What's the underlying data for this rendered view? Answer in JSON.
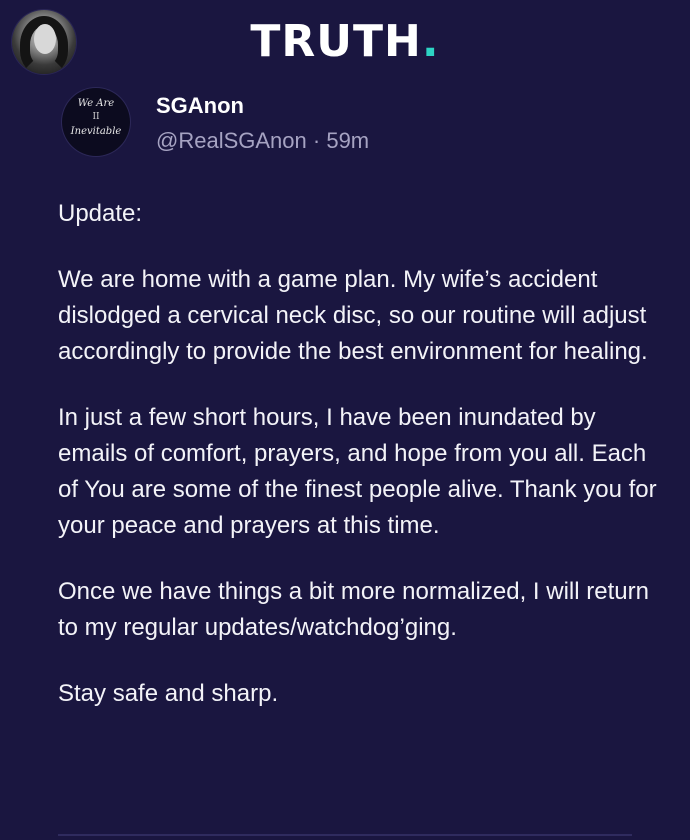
{
  "app": {
    "brand_text": "TRUTH",
    "brand_dot": ".",
    "accent_color": "#2dd4c4",
    "background_color": "#1a1640"
  },
  "viewer": {
    "avatar_icon": "user-avatar-photo"
  },
  "post": {
    "author": {
      "display_name": "SGAnon",
      "handle": "@RealSGAnon",
      "separator": "·",
      "time": "59m",
      "avatar_text_line1": "We Are",
      "avatar_text_line2": "II",
      "avatar_text_line3": "Inevitable"
    },
    "paragraphs": [
      "Update:",
      "We are home with a game plan. My wife’s accident dislodged a cervical neck disc, so our routine will adjust accordingly to provide the best environment for healing.",
      "In just a few short hours, I have been inundated by emails of comfort, prayers, and hope from you all. Each of You are some of the finest people alive. Thank you for your peace and prayers at this time.",
      "Once we have things a bit more normalized, I will return to my regular updates/watchdog’ging.",
      "Stay safe and sharp."
    ]
  }
}
